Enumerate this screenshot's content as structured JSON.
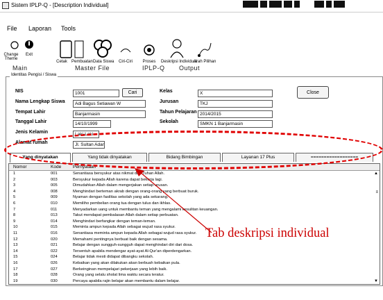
{
  "window": {
    "title": "Sistem IPLP-Q - [Description Individual]"
  },
  "menu": {
    "items": [
      "File",
      "Laporan",
      "Tools"
    ]
  },
  "ribbon": {
    "buttons": [
      "Change Theme",
      "Exit",
      "Cetak",
      "Pembuatan",
      "Data Siswa",
      "Ciri-Ciri",
      "Proses",
      "Deskripsi Individual",
      "Arah Pilihan"
    ],
    "groups": [
      "Main",
      "Master File",
      "IPLP-Q",
      "Output"
    ]
  },
  "form": {
    "legend": "Identitas Pengisi / Siswa",
    "labels": {
      "nis": "NIS",
      "nama": "Nama Lengkap Siswa",
      "tempat_lahir": "Tempat Lahir",
      "tanggal_lahir": "Tanggal Lahir",
      "jenis_kelamin": "Jenis Kelamin",
      "alamat": "Alamat rumah",
      "kelas": "Kelas",
      "jurusan": "Jurusan",
      "tahun_pelajaran": "Tahun Pelajaran",
      "sekolah": "Sekolah"
    },
    "values": {
      "nis": "1001",
      "nama": "Adi Bagus Setiawan W",
      "tempat_lahir": "Banjarmasin",
      "tanggal_lahir": "14/10/1999",
      "jenis_kelamin": "Laki-Laki",
      "alamat": "Jl. Sultan Adam",
      "kelas": "X",
      "jurusan": "TKJ",
      "tahun_pelajaran": "2014/2015",
      "sekolah": "SMKN 1 Banjarmasin"
    },
    "cari_button": "Cari",
    "close_button": "Close"
  },
  "tabs": [
    "Yang dinyatakan",
    "Yang tidak dinyatakan",
    "Bidang Bimbingan",
    "Layanan 17 Plus",
    "=================="
  ],
  "table": {
    "columns": [
      "Nomor",
      "Kode",
      "Pernyataan"
    ],
    "rows": [
      [
        "1",
        "001",
        "Senantiasa bersyukur atas nikmat dari Tuhan Allah."
      ],
      [
        "2",
        "003",
        "Bersyukur kepada Allah karena dapat bekerja lagi."
      ],
      [
        "3",
        "005",
        "Dimudahkan Allah dalam mengerjakan setiap urusan."
      ],
      [
        "4",
        "008",
        "Menghindari berteman akrab dengan orang-orang yang berbuat buruk."
      ],
      [
        "5",
        "009",
        "Nyaman dengan fasilitas sekolah yang ada sekarang."
      ],
      [
        "6",
        "010",
        "Memiliho pembelian orang tua dengan tulus dan ikhlas."
      ],
      [
        "7",
        "011",
        "Menyadarkan uang untuk membantu teman yang mengalami kesulitan keuangan."
      ],
      [
        "8",
        "013",
        "Takut mendapat pembalasan Allah dalam setiap perbuatan."
      ],
      [
        "9",
        "014",
        "Menghindari berfangkar dengan teman-teman."
      ],
      [
        "10",
        "015",
        "Meminta ampun kepada Allah sebagai wujud rasa syukur."
      ],
      [
        "11",
        "016",
        "Senantiasa meminta ampun kepada Allah sebagai wujud rasa syukur."
      ],
      [
        "12",
        "020",
        "Memahami pentingnya berbuat baik dengan sesama."
      ],
      [
        "13",
        "021",
        "Belajar dengan sungguh-sungguh dapat menghindari diri dari dosa."
      ],
      [
        "14",
        "022",
        "Tersentuh apabila mendengar ayat-ayat Al-Qur'an diperdengarkan."
      ],
      [
        "15",
        "024",
        "Belajar tidak mesti didapat dibangku sekolah."
      ],
      [
        "16",
        "026",
        "Kebaikan yang akan dilakukan akan berbuah kebaikan pula."
      ],
      [
        "17",
        "027",
        "Berkeinginan mempelajari pekerjaan yang lebih baik."
      ],
      [
        "18",
        "028",
        "Orang yang selalu sholat lima waktu secara teratur."
      ],
      [
        "19",
        "030",
        "Percaya apabila rajin belajar akan membantu dalam belajar."
      ]
    ]
  },
  "annotation": {
    "text": "Tab deskripsi individual",
    "color": "#cc0000"
  }
}
